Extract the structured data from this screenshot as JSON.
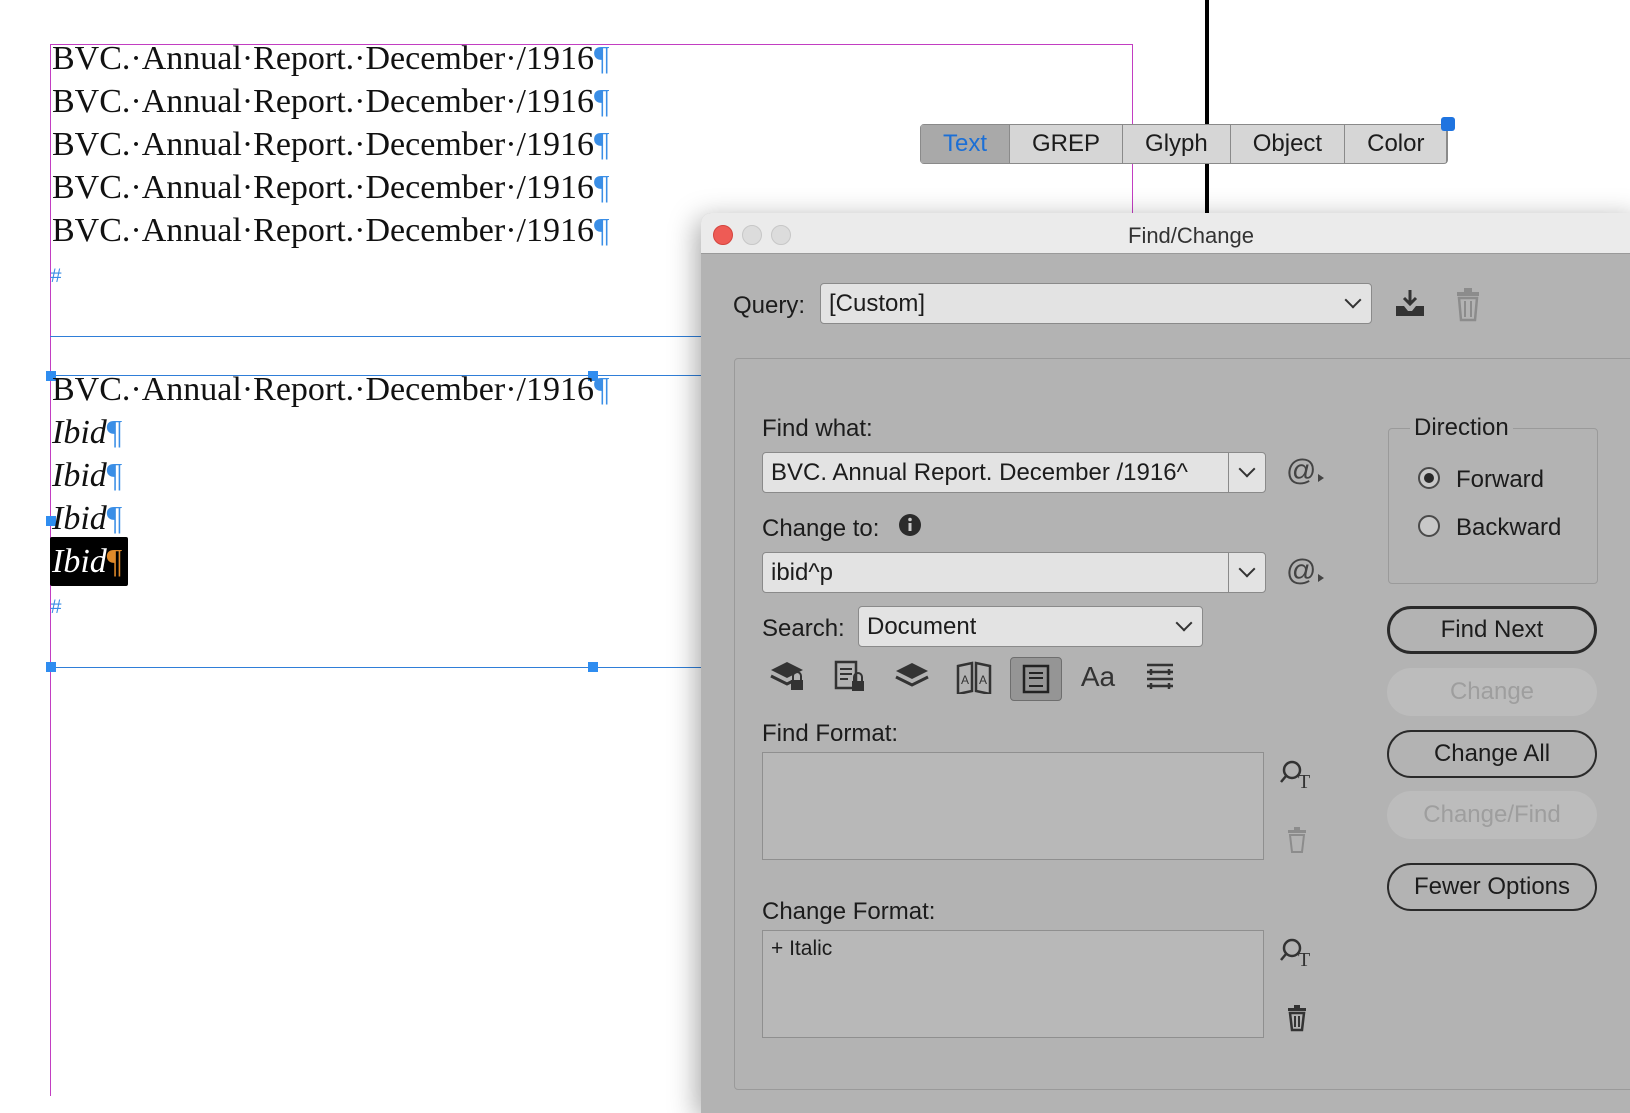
{
  "document": {
    "top_lines": [
      {
        "text": "BVC.·Annual·Report.·December·/1916",
        "end": "¶"
      },
      {
        "text": "BVC.·Annual·Report.·December·/1916",
        "end": "¶"
      },
      {
        "text": "BVC.·Annual·Report.·December·/1916",
        "end": "¶"
      },
      {
        "text": "BVC.·Annual·Report.·December·/1916",
        "end": "¶"
      },
      {
        "text": "BVC.·Annual·Report.·December·/1916",
        "end": "¶"
      }
    ],
    "end_marker": "#",
    "bottom_first": {
      "text": "BVC.·Annual·Report.·December·/1916",
      "end": "¶"
    },
    "ibid_lines": [
      {
        "text": "Ibid",
        "end": "¶"
      },
      {
        "text": "Ibid",
        "end": "¶"
      },
      {
        "text": "Ibid",
        "end": "¶"
      },
      {
        "text": "Ibid",
        "end": "¶"
      }
    ]
  },
  "dialog": {
    "title": "Find/Change",
    "query_label": "Query:",
    "query_value": "[Custom]",
    "tabs": [
      "Text",
      "GREP",
      "Glyph",
      "Object",
      "Color"
    ],
    "active_tab": "Text",
    "find_what_label": "Find what:",
    "find_what_value": "BVC. Annual Report. December /1916^",
    "change_to_label": "Change to:",
    "change_to_value": "ibid^p",
    "search_label": "Search:",
    "search_value": "Document",
    "find_format_label": "Find Format:",
    "change_format_label": "Change Format:",
    "change_format_items": [
      "+ Italic"
    ],
    "direction_label": "Direction",
    "direction_options": [
      "Forward",
      "Backward"
    ],
    "direction_selected": "Forward",
    "buttons": {
      "find_next": "Find Next",
      "change": "Change",
      "change_all": "Change All",
      "change_find": "Change/Find",
      "fewer_options": "Fewer Options"
    },
    "icons": [
      "save-query-icon",
      "delete-query-icon",
      "special-char-icon",
      "info-icon",
      "include-locked-layers-icon",
      "include-locked-stories-icon",
      "include-hidden-layers-icon",
      "include-master-pages-icon",
      "include-footnotes-icon",
      "case-sensitive-icon",
      "whole-word-icon",
      "find-format-icon",
      "clear-format-icon"
    ],
    "accent_color": "#1b6fd6"
  }
}
